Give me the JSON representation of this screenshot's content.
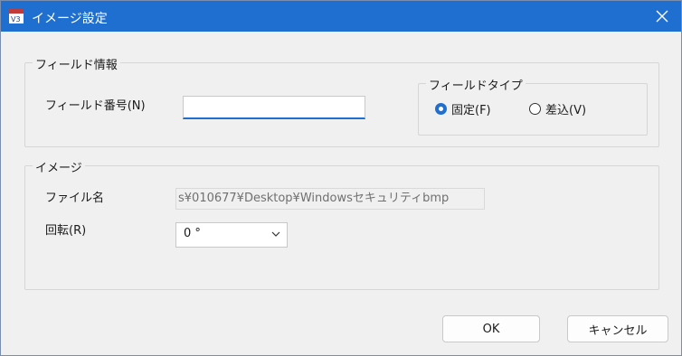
{
  "window": {
    "title": "イメージ設定",
    "app_icon": "app-icon-v3",
    "accent": "#1f6fd1"
  },
  "field_info": {
    "legend": "フィールド情報",
    "field_number_label": "フィールド番号(N)",
    "field_number_value": "",
    "field_type": {
      "legend": "フィールドタイプ",
      "options": [
        {
          "label": "固定(F)",
          "selected": true
        },
        {
          "label": "差込(V)",
          "selected": false
        }
      ]
    }
  },
  "image": {
    "legend": "イメージ",
    "file_name_label": "ファイル名",
    "file_name_value": "s¥010677¥Desktop¥Windowsセキュリティbmp",
    "rotation_label": "回転(R)",
    "rotation_value": "0 °"
  },
  "buttons": {
    "ok": "OK",
    "cancel": "キャンセル"
  }
}
